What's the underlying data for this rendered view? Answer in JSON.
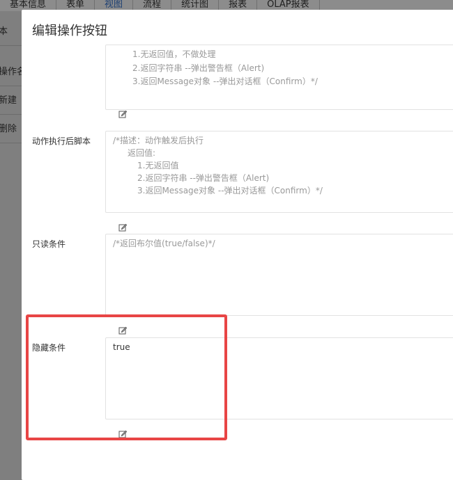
{
  "background": {
    "tabs": [
      {
        "label": "基本信息"
      },
      {
        "label": "表单"
      },
      {
        "label": "视图",
        "active": true
      },
      {
        "label": "流程"
      },
      {
        "label": "统计图"
      },
      {
        "label": "报表"
      },
      {
        "label": "OLAP报表"
      }
    ],
    "sidebar": [
      "本",
      "操作名",
      "新建",
      "删除"
    ]
  },
  "modal": {
    "title": "编辑操作按钮",
    "before_script_tail": {
      "lines": [
        "1.无返回值，不做处理",
        "2.返回字符串      --弹出警告框（Alert)",
        "3.返回Message对象 --弹出对话框（Confirm）*/"
      ]
    },
    "after_script": {
      "label": "动作执行后脚本",
      "lines": [
        "/*描述：动作触发后执行",
        "返回值:",
        "1.无返回值",
        "2.返回字符串      --弹出警告框（Alert)",
        "3.返回Message对象 --弹出对话框（Confirm）*/"
      ]
    },
    "readonly_condition": {
      "label": "只读条件",
      "placeholder": "/*返回布尔值(true/false)*/"
    },
    "hidden_condition": {
      "label": "隐藏条件",
      "value": "true"
    }
  },
  "icons": {
    "edit": "edit-icon"
  },
  "colors": {
    "highlight": "#e84545",
    "active_tab": "#1c3f73"
  }
}
